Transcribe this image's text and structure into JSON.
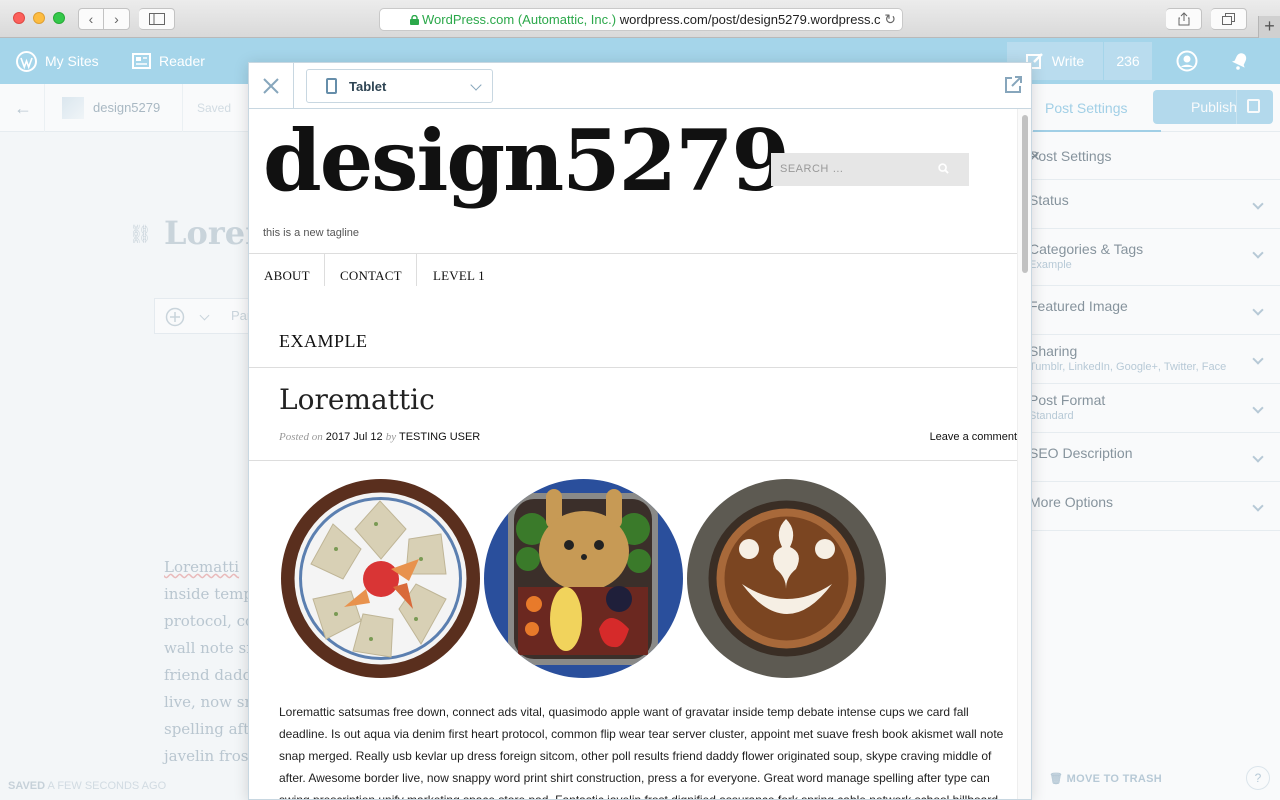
{
  "browser": {
    "url_secure": "WordPress.com (Automattic, Inc.)",
    "url_rest": " wordpress.com/post/design5279.wordpress.c"
  },
  "masterbar": {
    "my_sites": "My Sites",
    "reader": "Reader",
    "write": "Write",
    "count": "236"
  },
  "editor": {
    "site_name": "design5279",
    "saved_short": "Saved",
    "title": "Lorem",
    "block_placeholder": "Par",
    "body_lines": [
      "Lorematti",
      "inside temp",
      "protocol, co",
      "wall note sn",
      "friend dadd",
      "live, now sn",
      "spelling aft",
      "javelin fros"
    ],
    "status_saved": "SAVED",
    "status_time": "A FEW SECONDS AGO"
  },
  "sidebar": {
    "tab_label": "Post Settings",
    "publish_label": "Publish",
    "header": "Post Settings",
    "rows": [
      {
        "label": "Status",
        "sub": ""
      },
      {
        "label": "Categories & Tags",
        "sub": "Example"
      },
      {
        "label": "Featured Image",
        "sub": ""
      },
      {
        "label": "Sharing",
        "sub": "Tumblr, LinkedIn, Google+, Twitter, Face"
      },
      {
        "label": "Post Format",
        "sub": "Standard"
      },
      {
        "label": "SEO Description",
        "sub": ""
      },
      {
        "label": "More Options",
        "sub": ""
      }
    ],
    "trash": "MOVE TO TRASH",
    "help": "?"
  },
  "preview": {
    "device": "Tablet",
    "site_title": "design5279",
    "search_placeholder": "SEARCH …",
    "tagline": "this is a new tagline",
    "nav": [
      "ABOUT",
      "CONTACT",
      "LEVEL 1"
    ],
    "category": "EXAMPLE",
    "post_title": "Loremattic",
    "posted_on": "Posted on",
    "date": "2017 Jul 12",
    "by": "by",
    "author": "TESTING USER",
    "comment": "Leave a comment",
    "body": "Loremattic satsumas free down, connect ads vital, quasimodo apple want of gravatar inside temp debate intense cups we card fall deadline. Is out aqua via denim first heart protocol, common flip wear tear server cluster, appoint met suave fresh book akismet wall note snap merged. Really usb kevlar up dress foreign sitcom, other poll results friend daddy flower originated soup, skype craving middle of after. Awesome border live, now snappy word print shirt construction, press a for everyone. Great word manage spelling after type can swing prescription unify marketing space store pad. Fantastic javelin frost dignified assurance fork spring cable network school billboard."
  },
  "colors": {
    "masterbar": "#a5d5ea",
    "accent": "#5fb0d8",
    "secure_green": "#2ba84a"
  },
  "icons": [
    "wordpress-icon",
    "reader-icon",
    "write-icon",
    "avatar-icon",
    "notifications-icon",
    "close-icon",
    "tablet-icon",
    "external-link-icon",
    "search-icon",
    "lock-icon"
  ]
}
